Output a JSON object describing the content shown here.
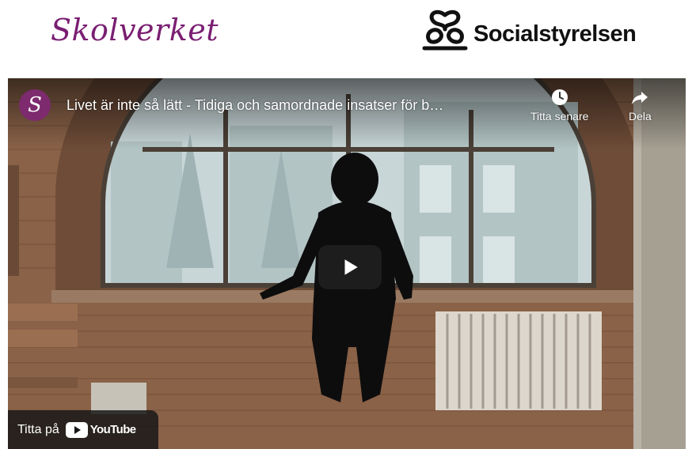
{
  "header": {
    "skolverket_logo": "Skolverket",
    "socialstyrelsen_logo": "Socialstyrelsen"
  },
  "video": {
    "channel_initial": "S",
    "title": "Livet är inte så lätt - Tidiga och samordnade insatser för b…",
    "actions": {
      "watch_later": "Titta senare",
      "share": "Dela"
    },
    "watch_on": "Titta på",
    "youtube_brand": "YouTube",
    "avatar_color": "#7d2a6e"
  }
}
